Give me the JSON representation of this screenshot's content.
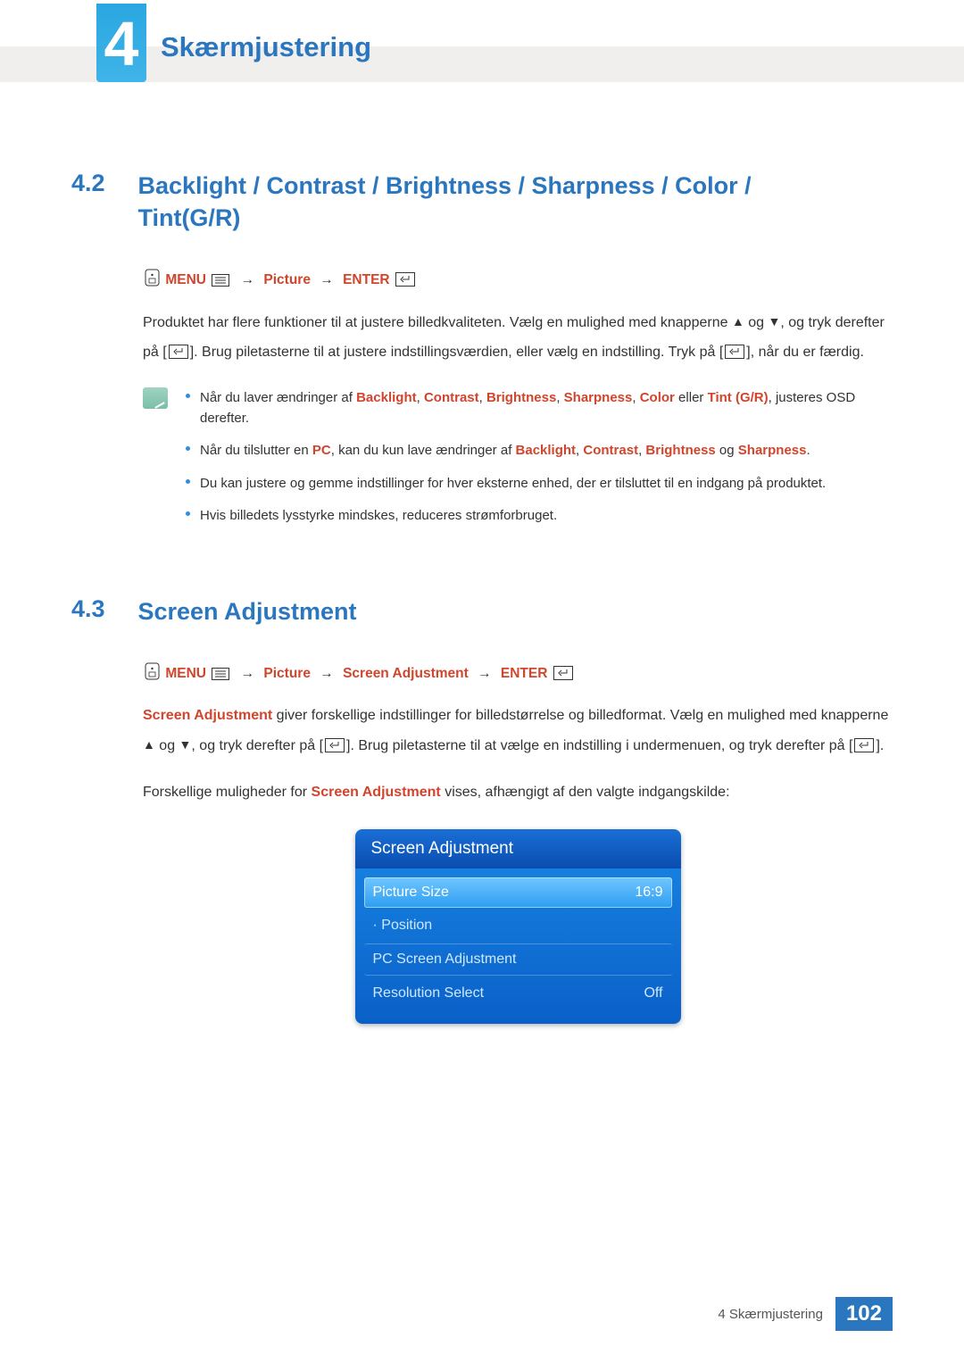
{
  "chapter": {
    "number": "4",
    "title": "Skærmjustering"
  },
  "section42": {
    "num": "4.2",
    "title": "Backlight / Contrast / Brightness / Sharpness / Color / Tint(G/R)",
    "nav": {
      "menu": "MENU",
      "l1": "Picture",
      "enter": "ENTER"
    },
    "para1a": "Produktet har flere funktioner til at justere billedkvaliteten. Vælg en mulighed med knapperne ",
    "para1b": " og ",
    "para1c": ", og tryk derefter på [",
    "para1d": "]. Brug piletasterne til at justere indstillingsværdien, eller vælg en indstilling. Tryk på [",
    "para1e": "], når du er færdig.",
    "notes": {
      "n1a": "Når du laver ændringer af ",
      "n1_backlight": "Backlight",
      "n1_contrast": "Contrast",
      "n1_brightness": "Brightness",
      "n1_sharpness": "Sharpness",
      "n1_color": "Color",
      "n1_or": " eller ",
      "n1_tint": "Tint (G/R)",
      "n1b": ", justeres OSD derefter.",
      "n2a": "Når du tilslutter en ",
      "n2_pc": "PC",
      "n2b": ", kan du kun lave ændringer af ",
      "n2_and": " og ",
      "n2c": ".",
      "n3": "Du kan justere og gemme indstillinger for hver eksterne enhed, der er tilsluttet til en indgang på produktet.",
      "n4": "Hvis billedets lysstyrke mindskes, reduceres strømforbruget."
    }
  },
  "section43": {
    "num": "4.3",
    "title": "Screen Adjustment",
    "nav": {
      "menu": "MENU",
      "l1": "Picture",
      "l2": "Screen Adjustment",
      "enter": "ENTER"
    },
    "para1a": " giver forskellige indstillinger for billedstørrelse og billedformat. Vælg en mulighed med knapperne ",
    "para1b": " og ",
    "para1c": ", og tryk derefter på [",
    "para1d": "]. Brug piletasterne til at vælge en indstilling i undermenuen, og tryk derefter på [",
    "para1e": "].",
    "lead": "Screen Adjustment",
    "para2a": "Forskellige muligheder for ",
    "para2b": " vises, afhængigt af den valgte indgangskilde:"
  },
  "osd": {
    "header": "Screen Adjustment",
    "rows": [
      {
        "label": "Picture Size",
        "value": "16:9"
      },
      {
        "label": "· Position",
        "value": ""
      },
      {
        "label": "PC Screen Adjustment",
        "value": ""
      },
      {
        "label": "Resolution Select",
        "value": "Off"
      }
    ]
  },
  "footer": {
    "chapter_label": "4 Skærmjustering",
    "page": "102"
  }
}
